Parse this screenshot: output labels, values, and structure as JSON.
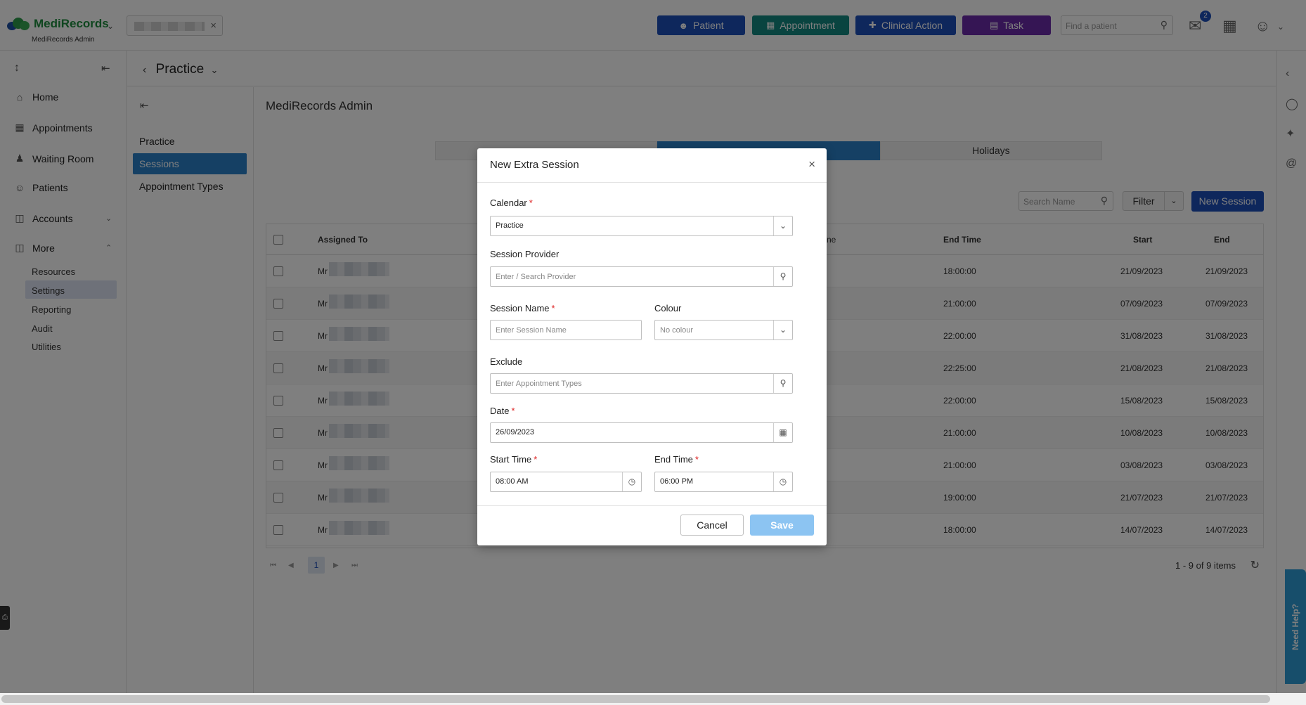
{
  "header": {
    "brand": "MediRecords",
    "brand_sub": "MediRecords Admin",
    "buttons": {
      "patient": "Patient",
      "appointment": "Appointment",
      "clinical_action": "Clinical Action",
      "task": "Task"
    },
    "find_patient_placeholder": "Find a patient",
    "mail_badge": "2",
    "colors": {
      "patient": "#1d4fb8",
      "appointment": "#138880",
      "clinical_action": "#1d4fb8",
      "task": "#6b2ba8"
    }
  },
  "sidebar": {
    "items": [
      {
        "label": "Home",
        "icon": "home-icon"
      },
      {
        "label": "Appointments",
        "icon": "calendar-icon"
      },
      {
        "label": "Waiting Room",
        "icon": "waiting-room-icon"
      },
      {
        "label": "Patients",
        "icon": "patients-icon"
      },
      {
        "label": "Accounts",
        "icon": "folder-icon"
      },
      {
        "label": "More",
        "icon": "more-icon"
      }
    ],
    "sub_items": [
      "Resources",
      "Settings",
      "Reporting",
      "Audit",
      "Utilities"
    ]
  },
  "practice": {
    "title": "Practice"
  },
  "secnav": {
    "items": [
      "Practice",
      "Sessions",
      "Appointment Types"
    ]
  },
  "main": {
    "title": "MediRecords Admin",
    "tabs": [
      "",
      "",
      "Holidays"
    ],
    "search_placeholder": "Search Name",
    "filter_label": "Filter",
    "new_session_label": "New Session",
    "columns": {
      "assigned_to": "Assigned To",
      "end_time_partial": "ne",
      "end_time": "End Time",
      "start": "Start",
      "end": "End"
    },
    "rows": [
      {
        "name": "Mr",
        "end_time": "18:00:00",
        "start": "21/09/2023",
        "end": "21/09/2023"
      },
      {
        "name": "Mr",
        "end_time": "21:00:00",
        "start": "07/09/2023",
        "end": "07/09/2023"
      },
      {
        "name": "Mr",
        "end_time": "22:00:00",
        "start": "31/08/2023",
        "end": "31/08/2023"
      },
      {
        "name": "Mr",
        "end_time": "22:25:00",
        "start": "21/08/2023",
        "end": "21/08/2023"
      },
      {
        "name": "Mr",
        "end_time": "22:00:00",
        "start": "15/08/2023",
        "end": "15/08/2023"
      },
      {
        "name": "Mr",
        "end_time": "21:00:00",
        "start": "10/08/2023",
        "end": "10/08/2023"
      },
      {
        "name": "Mr",
        "end_time": "21:00:00",
        "start": "03/08/2023",
        "end": "03/08/2023"
      },
      {
        "name": "Mr",
        "end_time": "19:00:00",
        "start": "21/07/2023",
        "end": "21/07/2023"
      },
      {
        "name": "Mr",
        "end_time": "18:00:00",
        "start": "14/07/2023",
        "end": "14/07/2023"
      }
    ],
    "pager": {
      "current": "1",
      "info": "1 - 9 of 9 items"
    }
  },
  "help": {
    "label": "Need Help?"
  },
  "modal": {
    "title": "New Extra Session",
    "calendar": {
      "label": "Calendar",
      "value": "Practice"
    },
    "provider": {
      "label": "Session Provider",
      "placeholder": "Enter / Search Provider"
    },
    "session_name": {
      "label": "Session Name",
      "placeholder": "Enter Session Name"
    },
    "colour": {
      "label": "Colour",
      "value": "No colour"
    },
    "exclude": {
      "label": "Exclude",
      "placeholder": "Enter Appointment Types"
    },
    "date": {
      "label": "Date",
      "value": "26/09/2023"
    },
    "start_time": {
      "label": "Start Time",
      "value": "08:00 AM"
    },
    "end_time": {
      "label": "End Time",
      "value": "06:00 PM"
    },
    "cancel_label": "Cancel",
    "save_label": "Save",
    "required_mark": "*"
  }
}
